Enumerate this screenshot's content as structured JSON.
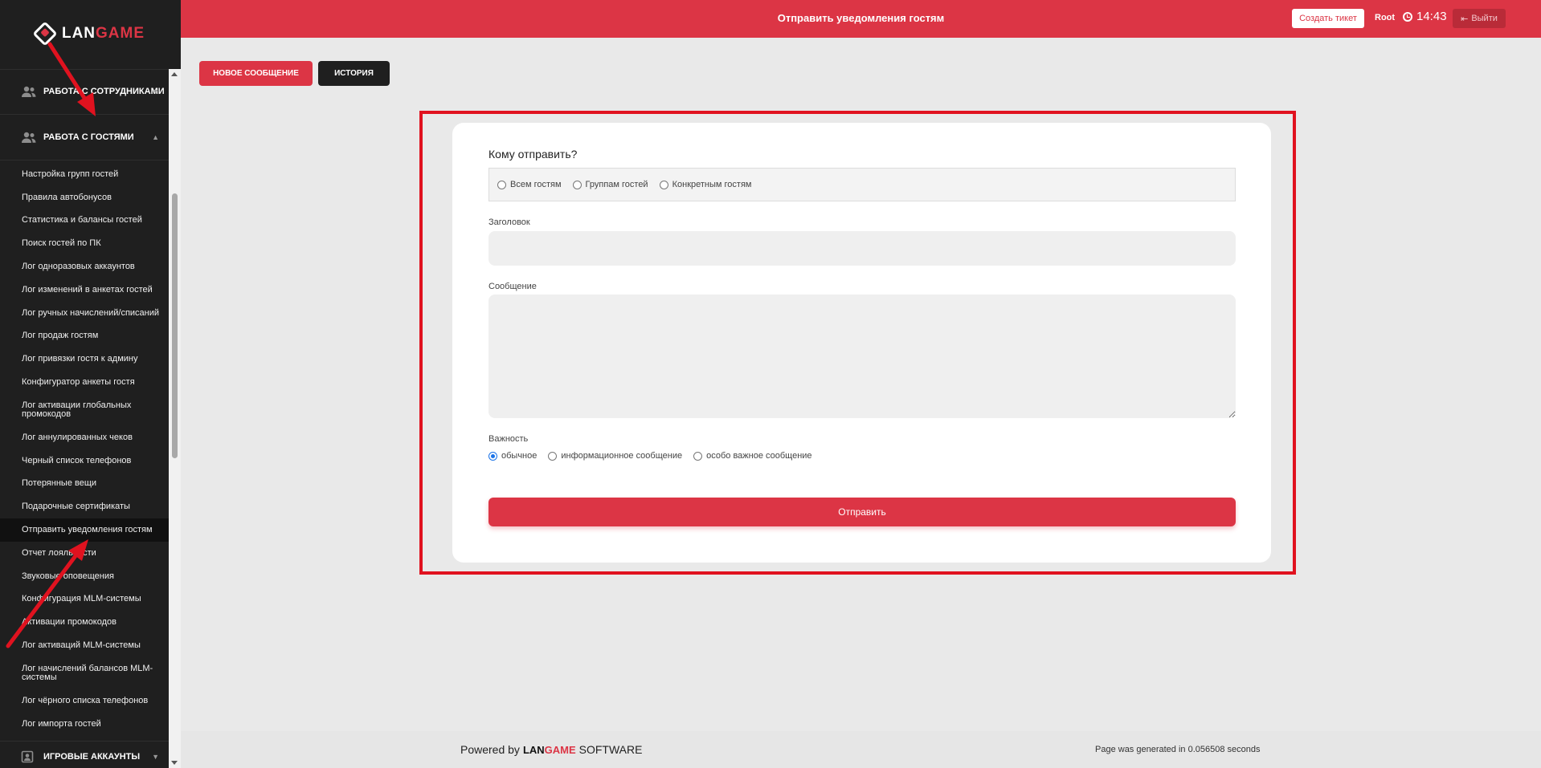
{
  "brand": {
    "left": "LAN",
    "right": "GAME"
  },
  "sidebar": {
    "section_staff": "Работа с сотрудниками",
    "section_guests": "Работа с гостями",
    "section_games": "Игровые аккаунты",
    "items": [
      "Настройка групп гостей",
      "Правила автобонусов",
      "Статистика и балансы гостей",
      "Поиск гостей по ПК",
      "Лог одноразовых аккаунтов",
      "Лог изменений в анкетах гостей",
      "Лог ручных начислений/списаний",
      "Лог продаж гостям",
      "Лог привязки гостя к админу",
      "Конфигуратор анкеты гостя",
      "Лог активации глобальных промокодов",
      "Лог аннулированных чеков",
      "Черный список телефонов",
      "Потерянные вещи",
      "Подарочные сертификаты",
      "Отправить уведомления гостям",
      "Отчет лояльности",
      "Звуковые оповещения",
      "Конфигурация MLM-системы",
      "Активации промокодов",
      "Лог активаций MLM-системы",
      "Лог начислений балансов MLM-системы",
      "Лог чёрного списка телефонов",
      "Лог импорта гостей"
    ],
    "active_index": 15
  },
  "header": {
    "title": "Отправить уведомления гостям",
    "ticket_label": "Создать тикет",
    "user": "Root",
    "time": "14:43",
    "logout_label": "Выйти"
  },
  "tabs": {
    "new_message": "Новое сообщение",
    "history": "История"
  },
  "form": {
    "title": "Кому отправить?",
    "recipients": [
      "Всем гостям",
      "Группам гостей",
      "Конкретным гостям"
    ],
    "title_label": "Заголовок",
    "title_value": "",
    "message_label": "Сообщение",
    "message_value": "",
    "importance_label": "Важность",
    "importance_options": [
      "обычное",
      "информационное сообщение",
      "особо важное сообщение"
    ],
    "importance_selected": 0,
    "submit_label": "Отправить"
  },
  "footer": {
    "powered_prefix": "Powered by",
    "powered_suffix": "SOFTWARE",
    "generated": "Page was generated in 0.056508 seconds"
  },
  "colors": {
    "accent": "#dc3545",
    "sidebar_bg": "#1f1f1f",
    "annotation": "#e0121f"
  }
}
